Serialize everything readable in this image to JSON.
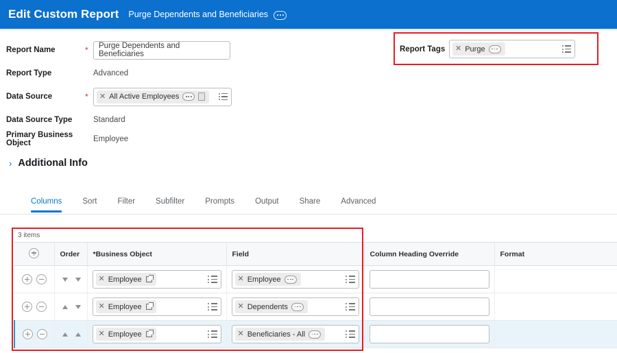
{
  "header": {
    "title": "Edit Custom Report",
    "subtitle": "Purge Dependents and Beneficiaries",
    "menu_icon": "ellipsis-icon",
    "background": "#0b70ce"
  },
  "form": {
    "report_name": {
      "label": "Report Name",
      "required_marker": "*",
      "value": "Purge Dependents and Beneficiaries",
      "placeholder": ""
    },
    "report_type": {
      "label": "Report Type",
      "value": "Advanced"
    },
    "data_source": {
      "label": "Data Source",
      "required_marker": "*",
      "pill": "All Active Employees",
      "remove_icon": "close-icon",
      "ellipsis_icon": "ellipsis-icon",
      "related_icon": "related-actions-icon",
      "menu_icon": "list-menu-icon"
    },
    "data_source_type": {
      "label": "Data Source Type",
      "value": "Standard"
    },
    "primary_business_object": {
      "label": "Primary Business Object",
      "value": "Employee"
    }
  },
  "report_tags": {
    "label": "Report Tags",
    "pill": "Purge",
    "remove_icon": "close-icon",
    "ellipsis_icon": "ellipsis-icon",
    "menu_icon": "list-menu-icon",
    "highlight_color": "#e81b23"
  },
  "additional_info": {
    "label": "Additional Info",
    "chevron": "›",
    "expanded": false
  },
  "tabs": {
    "active": "Columns",
    "accent": "#0875d1",
    "items": [
      {
        "label": "Columns"
      },
      {
        "label": "Sort"
      },
      {
        "label": "Filter"
      },
      {
        "label": "Subfilter"
      },
      {
        "label": "Prompts"
      },
      {
        "label": "Output"
      },
      {
        "label": "Share"
      },
      {
        "label": "Advanced"
      }
    ]
  },
  "table": {
    "items_count": "3 items",
    "add_row_icon": "plus-circle-icon",
    "columns": [
      {
        "label": ""
      },
      {
        "label": "Order"
      },
      {
        "label": "*Business Object"
      },
      {
        "label": "Field"
      },
      {
        "label": "Column Heading Override"
      },
      {
        "label": "Format"
      }
    ],
    "rows": [
      {
        "selected": false,
        "add_icon": "plus-circle-icon",
        "remove_icon": "minus-circle-icon",
        "order_icons": [
          "arrow-down-icon",
          "arrow-down-icon"
        ],
        "business_object": "Employee",
        "business_object_icon": "external-link-icon",
        "field": "Employee",
        "field_icon": "ellipsis-icon",
        "column_heading_override": "",
        "format": ""
      },
      {
        "selected": false,
        "add_icon": "plus-circle-icon",
        "remove_icon": "minus-circle-icon",
        "order_icons": [
          "arrow-up-icon",
          "arrow-down-icon"
        ],
        "business_object": "Employee",
        "business_object_icon": "external-link-icon",
        "field": "Dependents",
        "field_icon": "ellipsis-icon",
        "column_heading_override": "",
        "format": ""
      },
      {
        "selected": true,
        "add_icon": "plus-circle-icon",
        "remove_icon": "minus-circle-icon",
        "order_icons": [
          "arrow-up-icon",
          "arrow-up-icon"
        ],
        "business_object": "Employee",
        "business_object_icon": "external-link-icon",
        "field": "Beneficiaries - All",
        "field_icon": "ellipsis-icon",
        "column_heading_override": "",
        "format": ""
      }
    ],
    "highlight_color": "#e81b23"
  }
}
